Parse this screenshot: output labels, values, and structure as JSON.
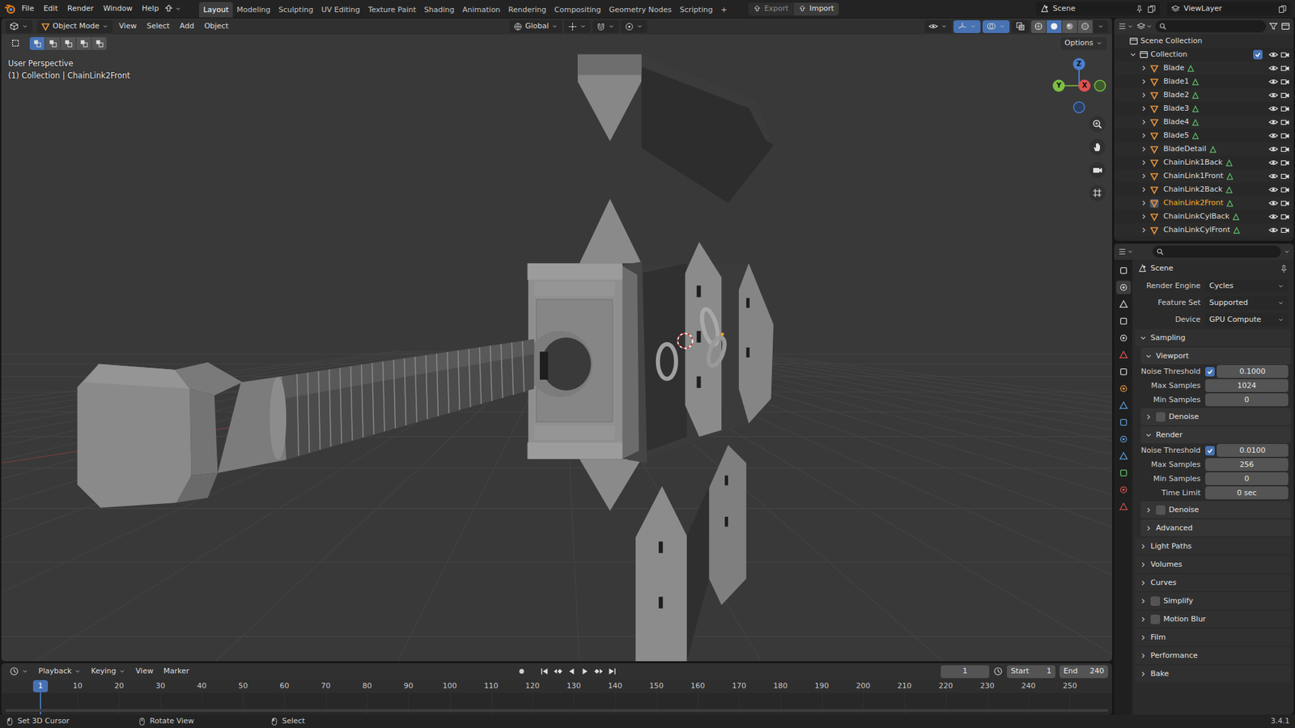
{
  "top_bar": {
    "menus": [
      "File",
      "Edit",
      "Render",
      "Window",
      "Help"
    ],
    "workspaces": [
      {
        "label": "Layout",
        "selected": true
      },
      {
        "label": "Modeling",
        "selected": false
      },
      {
        "label": "Sculpting",
        "selected": false
      },
      {
        "label": "UV Editing",
        "selected": false
      },
      {
        "label": "Texture Paint",
        "selected": false
      },
      {
        "label": "Shading",
        "selected": false
      },
      {
        "label": "Animation",
        "selected": false
      },
      {
        "label": "Rendering",
        "selected": false
      },
      {
        "label": "Compositing",
        "selected": false
      },
      {
        "label": "Geometry Nodes",
        "selected": false
      },
      {
        "label": "Scripting",
        "selected": false
      }
    ],
    "add_workspace": "+",
    "export": {
      "label": "Export",
      "disabled": true
    },
    "import": {
      "label": "Import",
      "disabled": false
    },
    "scene": "Scene",
    "view_layer": "ViewLayer"
  },
  "viewport": {
    "mode": "Object Mode",
    "menus": [
      "View",
      "Select",
      "Add",
      "Object"
    ],
    "orientation": "Global",
    "options": "Options",
    "perspective": "User Perspective",
    "context": "(1) Collection | ChainLink2Front",
    "gizmo_axes": [
      "Z",
      "Y",
      "X"
    ],
    "shading": [
      {
        "selected": false
      },
      {
        "selected": true
      },
      {
        "selected": false
      },
      {
        "selected": false
      }
    ]
  },
  "outliner": {
    "root": "Scene Collection",
    "collection": {
      "name": "Collection",
      "expanded": true,
      "checked": true,
      "visible": true
    },
    "objects": [
      {
        "name": "Blade",
        "selected": false,
        "expanded": false,
        "visible": true
      },
      {
        "name": "Blade1",
        "selected": false,
        "expanded": false,
        "visible": true
      },
      {
        "name": "Blade2",
        "selected": false,
        "expanded": false,
        "visible": true
      },
      {
        "name": "Blade3",
        "selected": false,
        "expanded": false,
        "visible": true
      },
      {
        "name": "Blade4",
        "selected": false,
        "expanded": false,
        "visible": true
      },
      {
        "name": "Blade5",
        "selected": false,
        "expanded": false,
        "visible": true
      },
      {
        "name": "BladeDetail",
        "selected": false,
        "expanded": false,
        "visible": true
      },
      {
        "name": "ChainLink1Back",
        "selected": false,
        "expanded": false,
        "visible": true
      },
      {
        "name": "ChainLink1Front",
        "selected": false,
        "expanded": false,
        "visible": true
      },
      {
        "name": "ChainLink2Back",
        "selected": false,
        "expanded": false,
        "visible": true
      },
      {
        "name": "ChainLink2Front",
        "selected": true,
        "expanded": false,
        "visible": true
      },
      {
        "name": "ChainLinkCylBack",
        "selected": false,
        "expanded": false,
        "visible": true
      },
      {
        "name": "ChainLinkCylFront",
        "selected": false,
        "expanded": false,
        "visible": true
      }
    ]
  },
  "properties": {
    "title": "Scene",
    "tabs": [
      {
        "selected": false
      },
      {
        "selected": true
      },
      {
        "selected": false
      },
      {
        "selected": false
      },
      {
        "selected": false
      },
      {
        "selected": false
      },
      {
        "selected": false
      },
      {
        "selected": false
      },
      {
        "selected": false
      },
      {
        "selected": false
      },
      {
        "selected": false
      },
      {
        "selected": false
      },
      {
        "selected": false
      },
      {
        "selected": false
      },
      {
        "selected": false
      }
    ],
    "rows": [
      {
        "kind": "field",
        "label": "Render Engine",
        "value": "Cycles"
      },
      {
        "kind": "field",
        "label": "Feature Set",
        "value": "Supported"
      },
      {
        "kind": "field",
        "label": "Device",
        "value": "GPU Compute"
      },
      {
        "kind": "panel",
        "label": "Sampling",
        "expanded": true
      },
      {
        "kind": "subpanel",
        "label": "Viewport",
        "expanded": true
      },
      {
        "kind": "checknumber",
        "label": "Noise Threshold",
        "checked": true,
        "value": "0.1000"
      },
      {
        "kind": "number",
        "label": "Max Samples",
        "value": "1024"
      },
      {
        "kind": "number",
        "label": "Min Samples",
        "value": "0"
      },
      {
        "kind": "checksubpanel",
        "label": "Denoise",
        "checked": false,
        "expanded": false
      },
      {
        "kind": "subpanel",
        "label": "Render",
        "expanded": true
      },
      {
        "kind": "checknumber",
        "label": "Noise Threshold",
        "checked": true,
        "value": "0.0100"
      },
      {
        "kind": "number",
        "label": "Max Samples",
        "value": "256"
      },
      {
        "kind": "number",
        "label": "Min Samples",
        "value": "0"
      },
      {
        "kind": "number",
        "label": "Time Limit",
        "value": "0 sec"
      },
      {
        "kind": "checksubpanel",
        "label": "Denoise",
        "checked": false,
        "expanded": false
      },
      {
        "kind": "subpanel",
        "label": "Advanced",
        "expanded": false
      },
      {
        "kind": "panel",
        "label": "Light Paths",
        "expanded": false
      },
      {
        "kind": "panel",
        "label": "Volumes",
        "expanded": false
      },
      {
        "kind": "panel",
        "label": "Curves",
        "expanded": false
      },
      {
        "kind": "checkpanel",
        "label": "Simplify",
        "checked": false,
        "expanded": false
      },
      {
        "kind": "checkpanel",
        "label": "Motion Blur",
        "checked": false,
        "expanded": false
      },
      {
        "kind": "panel",
        "label": "Film",
        "expanded": false
      },
      {
        "kind": "panel",
        "label": "Performance",
        "expanded": false
      },
      {
        "kind": "panel",
        "label": "Bake",
        "expanded": false
      }
    ]
  },
  "timeline": {
    "menus": [
      "Playback",
      "Keying",
      "View",
      "Marker"
    ],
    "current_frame": "1",
    "start_label": "Start",
    "start": "1",
    "end_label": "End",
    "end": "240",
    "ticks": [
      "10",
      "20",
      "30",
      "40",
      "50",
      "60",
      "70",
      "80",
      "90",
      "100",
      "110",
      "120",
      "130",
      "140",
      "150",
      "160",
      "170",
      "180",
      "190",
      "200",
      "210",
      "220",
      "230",
      "240",
      "250"
    ],
    "playhead": "1"
  },
  "status_bar": {
    "hints": [
      "Set 3D Cursor",
      "Rotate View",
      "Select"
    ],
    "version": "3.4.1"
  }
}
